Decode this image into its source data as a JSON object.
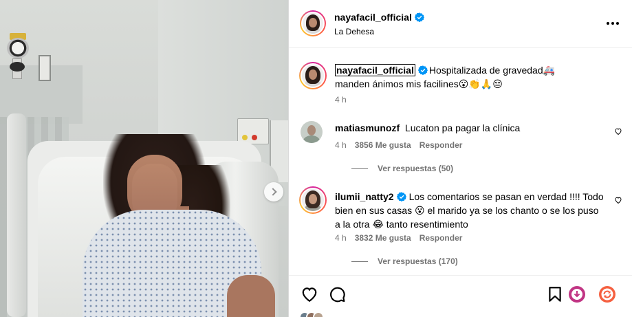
{
  "post": {
    "username": "nayafacil_official",
    "location": "La Dehesa",
    "more_icon": "more-horizontal-icon",
    "verified_icon": "verified-badge-icon"
  },
  "caption": {
    "username": "nayafacil_official",
    "text": "Hospitalizada de gravedad🚑 manden ánimos mis facilines😮👏🙏😔",
    "time": "4 h"
  },
  "comments": [
    {
      "username": "matiasmunozf",
      "text": "Lucaton pa pagar la clínica",
      "time": "4 h",
      "likes": "3856 Me gusta",
      "reply_label": "Responder",
      "view_replies": "Ver respuestas (50)"
    },
    {
      "username": "ilumii_natty2",
      "text": "Los comentarios se pasan en verdad !!!! Todo bien en sus casas 😮 el marido ya se los chanto o se los puso a la otra 😂 tanto resentimiento",
      "time": "4 h",
      "likes": "3832 Me gusta",
      "reply_label": "Responder",
      "view_replies": "Ver respuestas (170)"
    }
  ],
  "actions": {
    "like_icon": "heart-icon",
    "comment_icon": "comment-icon",
    "save_icon": "bookmark-icon",
    "download_icon": "download-icon",
    "repost_icon": "repost-icon"
  },
  "colors": {
    "verified": "#0095f6",
    "muted": "#737373",
    "divider": "#efefef",
    "download_accent": "#c13584",
    "repost_accent": "#f56040"
  },
  "media": {
    "next_icon": "chevron-right-icon"
  }
}
